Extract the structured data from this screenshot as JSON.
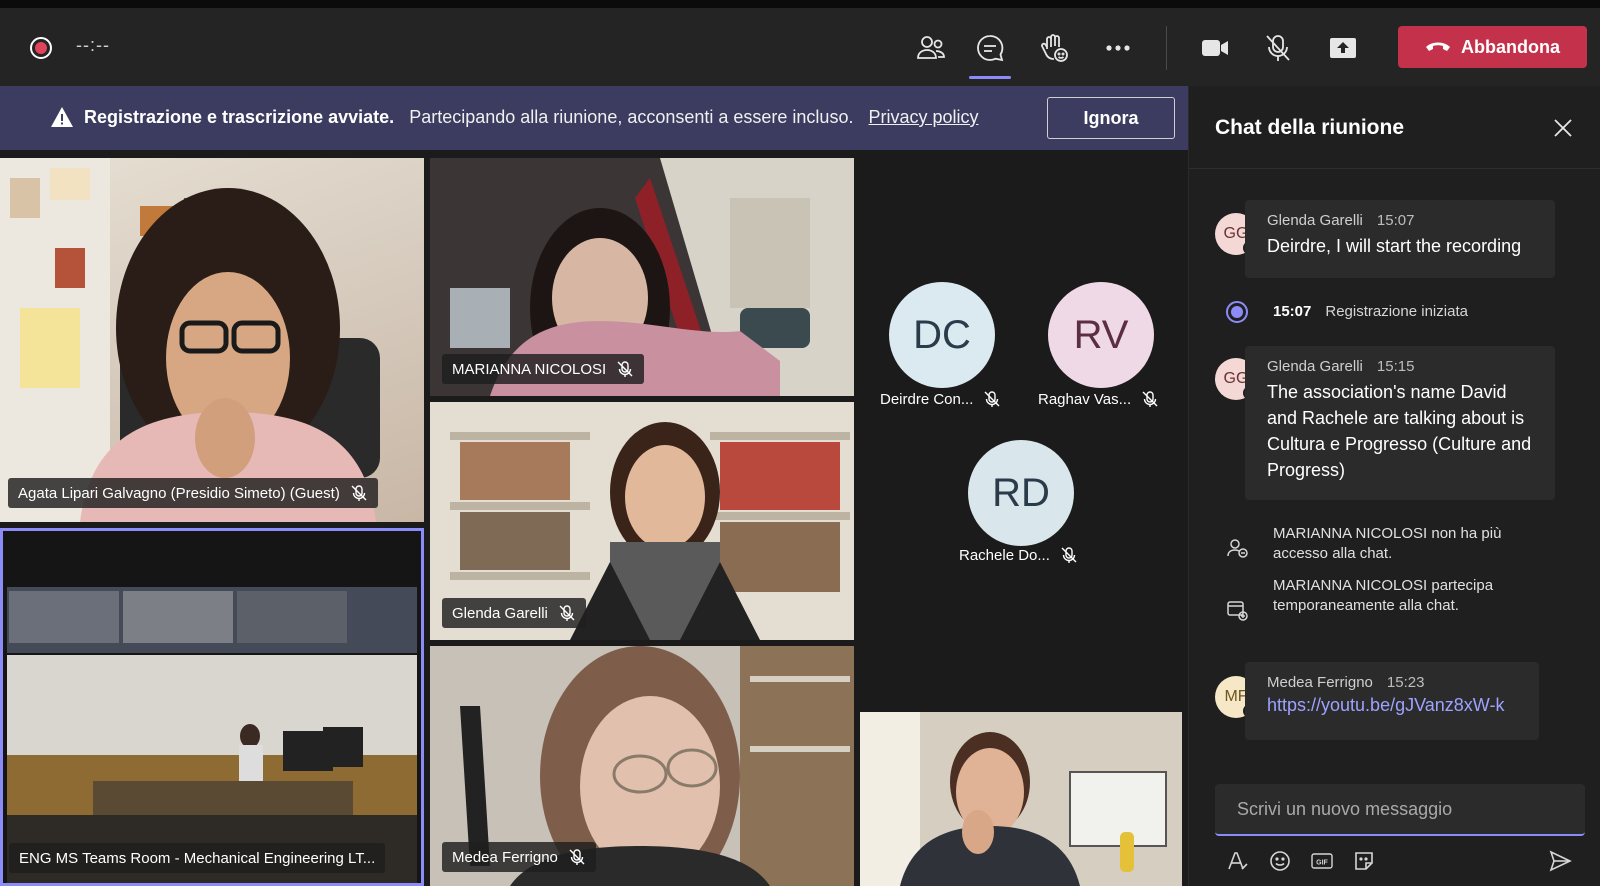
{
  "toolbar": {
    "timer": "--:--",
    "leave_label": "Abbandona",
    "icons": [
      "people-icon",
      "chat-icon",
      "raise-hand-icon",
      "more-icon",
      "camera-icon",
      "mic-off-icon",
      "share-icon"
    ]
  },
  "banner": {
    "bold_text": "Registrazione e trascrizione avviate.",
    "text": "Partecipando alla riunione, acconsenti a essere incluso.",
    "link": "Privacy policy",
    "ignore_label": "Ignora"
  },
  "participants": {
    "agata": "Agata Lipari Galvagno (Presidio Simeto) (Guest)",
    "marianna": "MARIANNA NICOLOSI",
    "glenda": "Glenda Garelli",
    "eng_room": "ENG MS Teams Room - Mechanical Engineering LT...",
    "medea": "Medea Ferrigno",
    "deirdre": {
      "initials": "DC",
      "name": "Deirdre Con..."
    },
    "raghav": {
      "initials": "RV",
      "name": "Raghav Vas..."
    },
    "rachele": {
      "initials": "RD",
      "name": "Rachele Do..."
    }
  },
  "chat": {
    "title": "Chat della riunione",
    "messages": [
      {
        "initials": "GG",
        "author": "Glenda Garelli",
        "time": "15:07",
        "text": "Deirdre, I will start the recording"
      },
      {
        "initials": "GG",
        "author": "Glenda Garelli",
        "time": "15:15",
        "text": "The association's name David and Rachele are talking about is Cultura e Progresso (Culture and Progress)"
      },
      {
        "initials": "MF",
        "author": "Medea Ferrigno",
        "time": "15:23",
        "link": "https://youtu.be/gJVanz8xW-k"
      }
    ],
    "system": {
      "recording_time": "15:07",
      "recording_text": "Registrazione iniziata",
      "left_text": "MARIANNA NICOLOSI non ha più accesso alla chat.",
      "joined_text": "MARIANNA NICOLOSI partecipa temporaneamente alla chat."
    },
    "compose_placeholder": "Scrivi un nuovo messaggio"
  },
  "colors": {
    "leave": "#c4314b",
    "accent": "#8b8cf7",
    "banner": "#3b3c60",
    "avatar_dc": "#dbe9f0",
    "avatar_rv": "#f0d9e6",
    "avatar_rd": "#d9e6ec"
  }
}
